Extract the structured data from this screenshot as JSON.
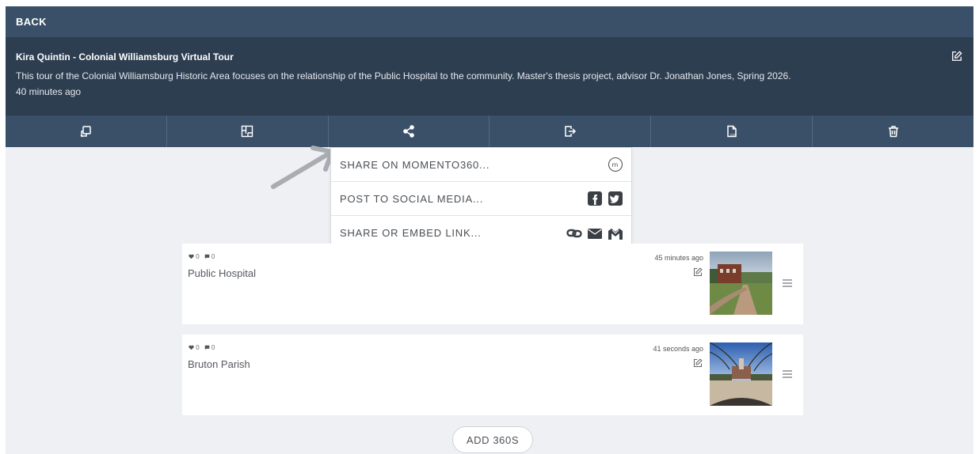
{
  "header": {
    "back_label": "BACK"
  },
  "tour": {
    "title": "Kira Quintin - Colonial Williamsburg Virtual Tour",
    "description": "This tour of the Colonial Williamsburg Historic Area focuses on the relationship of the Public Hospital to the community. Master's thesis project, advisor Dr. Jonathan Jones, Spring 2026.",
    "updated": "40 minutes ago"
  },
  "toolbar": {
    "icons": [
      "rotate-tour-icon",
      "floorplan-icon",
      "share-icon",
      "export-icon",
      "csv-icon",
      "trash-icon"
    ]
  },
  "share_menu": {
    "items": [
      {
        "label": "SHARE ON MOMENTO360...",
        "icons": [
          "momento-logo-icon"
        ]
      },
      {
        "label": "POST TO SOCIAL MEDIA...",
        "icons": [
          "facebook-icon",
          "twitter-icon"
        ]
      },
      {
        "label": "SHARE OR EMBED LINK...",
        "icons": [
          "link-icon",
          "email-icon",
          "moodle-icon"
        ]
      }
    ]
  },
  "scenes": [
    {
      "name": "Public Hospital",
      "likes": "0",
      "comments": "0",
      "updated": "45 minutes ago"
    },
    {
      "name": "Bruton Parish",
      "likes": "0",
      "comments": "0",
      "updated": "41 seconds ago"
    }
  ],
  "add_button_label": "ADD 360S",
  "colors": {
    "header": "#3a5068",
    "info": "#2e3e51",
    "background": "#eef0f4"
  }
}
